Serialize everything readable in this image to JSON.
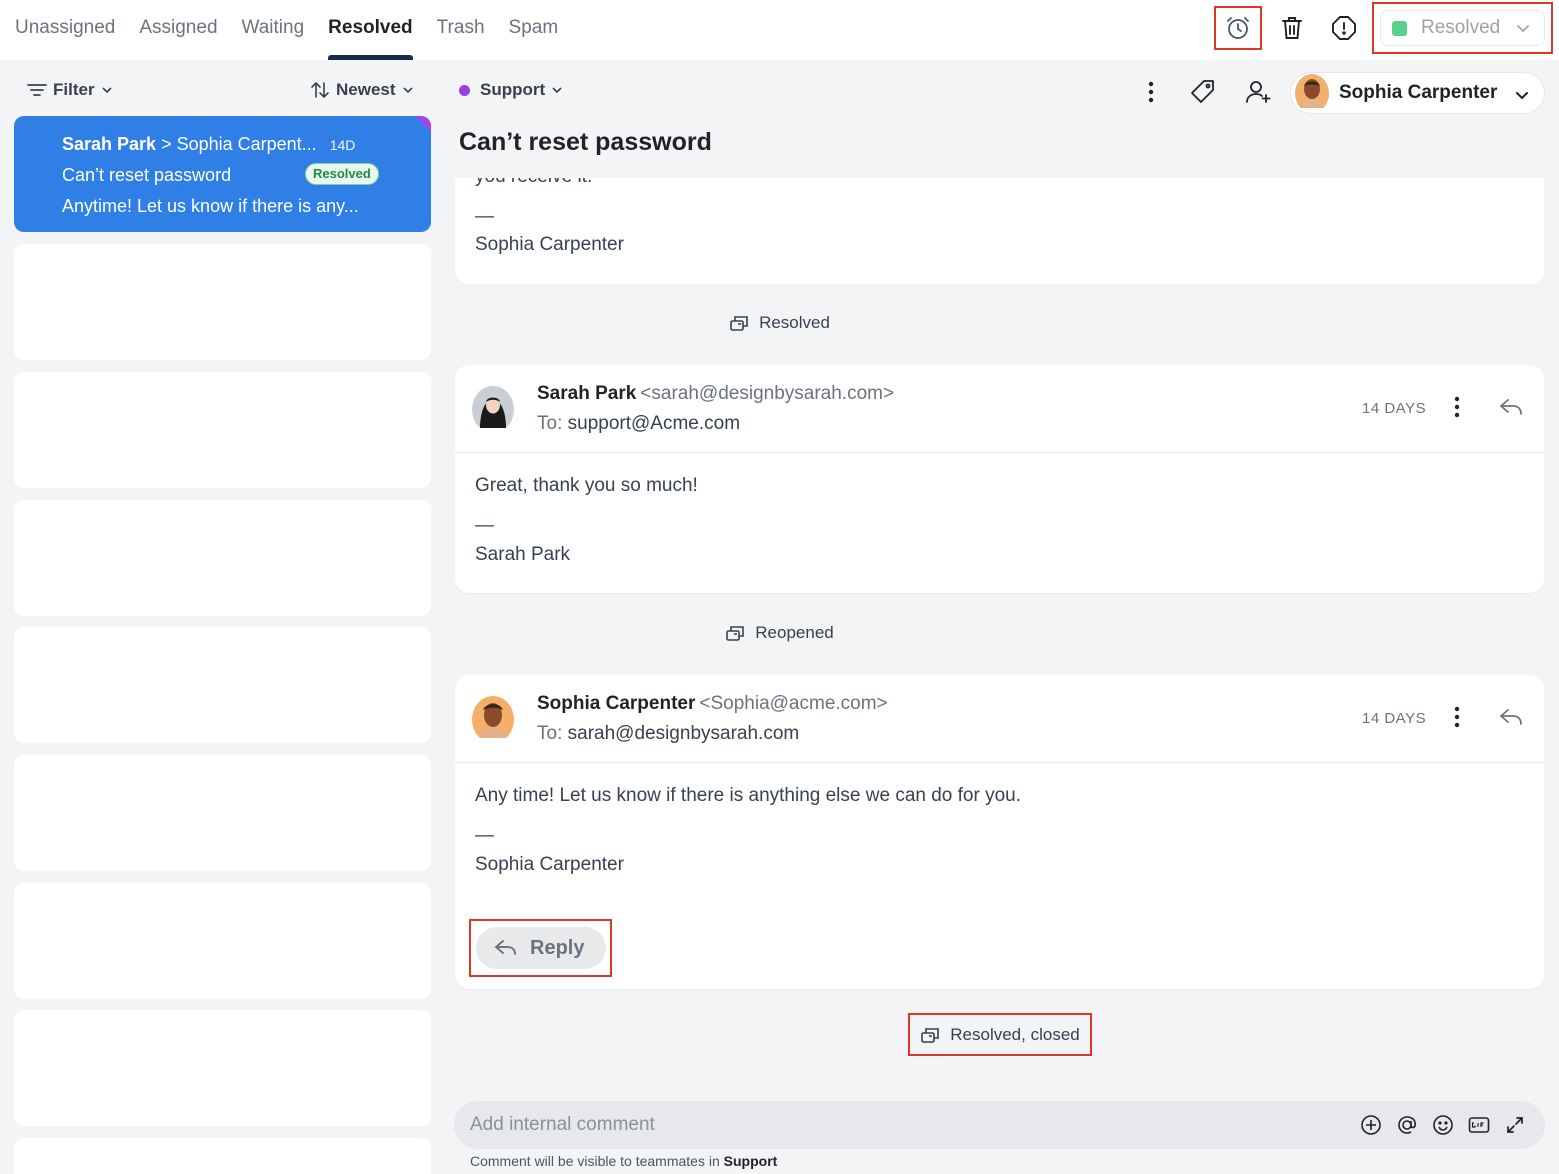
{
  "tabs": [
    {
      "label": "Unassigned",
      "active": false
    },
    {
      "label": "Assigned",
      "active": false
    },
    {
      "label": "Waiting",
      "active": false
    },
    {
      "label": "Resolved",
      "active": true
    },
    {
      "label": "Trash",
      "active": false
    },
    {
      "label": "Spam",
      "active": false
    }
  ],
  "status": {
    "label": "Resolved",
    "color": "#5bd08a"
  },
  "list": {
    "filter_label": "Filter",
    "sort_label": "Newest",
    "selected": {
      "from": "Sarah Park",
      "to": "Sophia Carpent...",
      "age": "14D",
      "subject": "Can’t reset password",
      "badge": "Resolved",
      "preview": "Anytime! Let us know if there is any..."
    }
  },
  "conversation": {
    "team": "Support",
    "assignee": "Sophia Carpenter",
    "subject": "Can’t reset password",
    "top_fragment": {
      "cut_text": "you receive it.",
      "dash": "—",
      "signature": "Sophia Carpenter"
    },
    "events": {
      "first": "Resolved",
      "second": "Reopened",
      "final": "Resolved, closed"
    },
    "messages": [
      {
        "sender": "Sarah Park",
        "email": "<sarah@designbysarah.com>",
        "to_label": "To:",
        "to": "support@Acme.com",
        "age": "14 DAYS",
        "body": "Great, thank you so much!",
        "dash": "—",
        "signature": "Sarah Park"
      },
      {
        "sender": "Sophia Carpenter",
        "email": "<Sophia@acme.com>",
        "to_label": "To:",
        "to": "sarah@designbysarah.com",
        "age": "14 DAYS",
        "body": "Any time! Let us know if there is anything else we can do for you.",
        "dash": "—",
        "signature": "Sophia Carpenter",
        "reply_label": "Reply"
      }
    ]
  },
  "composer": {
    "placeholder": "Add internal comment",
    "note_prefix": "Comment will be visible to teammates in",
    "note_team": "Support"
  }
}
